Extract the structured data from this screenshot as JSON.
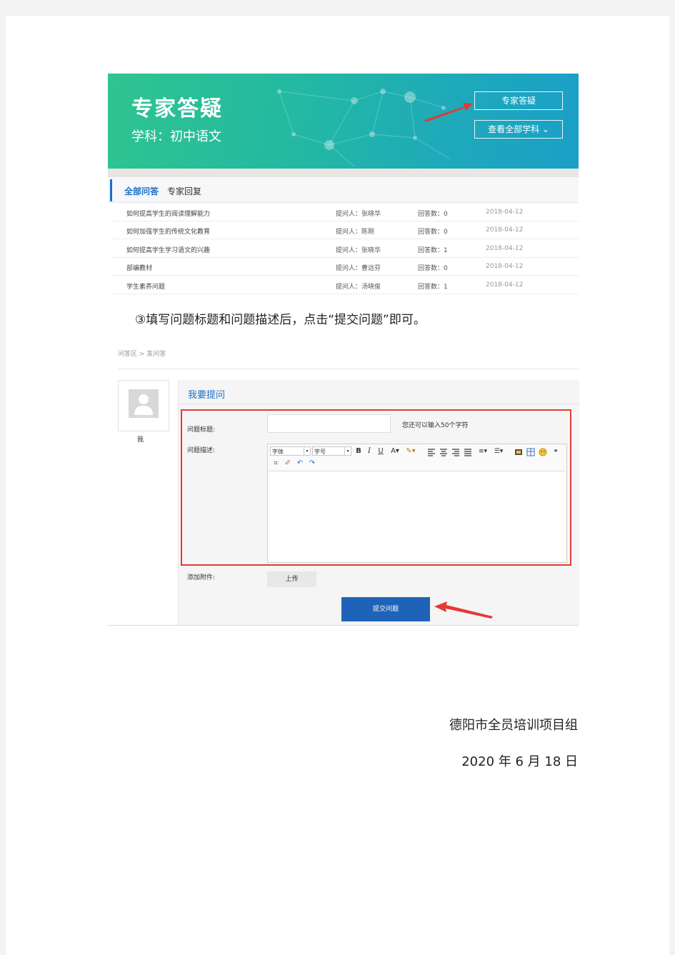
{
  "banner": {
    "title": "专家答疑",
    "subject": "学科：初中语文",
    "btn_expert": "专家答疑",
    "btn_all_subjects": "查看全部学科 ⌄"
  },
  "tabs": [
    "全部问答",
    "专家回复"
  ],
  "questions": [
    {
      "title": "如何提高学生的阅读理解能力",
      "asker": "提问人：张晓华",
      "answers": "回答数：0",
      "date": "2018-04-12"
    },
    {
      "title": "如何加强学生的传统文化教育",
      "asker": "提问人：陈刚",
      "answers": "回答数：0",
      "date": "2018-04-12"
    },
    {
      "title": "如何提高学生学习语文的兴趣",
      "asker": "提问人：张晓华",
      "answers": "回答数：1",
      "date": "2018-04-12"
    },
    {
      "title": "部编教材",
      "asker": "提问人：曹远芬",
      "answers": "回答数：0",
      "date": "2018-04-12"
    },
    {
      "title": "学生素养问题",
      "asker": "提问人：汤晓俊",
      "answers": "回答数：1",
      "date": "2018-04-12"
    }
  ],
  "instruction": "③填写问题标题和问题描述后，点击“提交问题”即可。",
  "form": {
    "breadcrumb": "问答区 > 发问答",
    "user_name": "我",
    "panel_title": "我要提问",
    "title_label": "问题标题:",
    "title_value": "",
    "title_hint": "您还可以输入50个字符",
    "desc_label": "问题描述:",
    "font_select": "字体",
    "size_select": "字号",
    "attach_label": "添加附件:",
    "upload_label": "上传",
    "submit_label": "提交问题"
  },
  "colors": {
    "accent": "#1b6fc6",
    "submit": "#1f63b8",
    "highlight": "#e53935"
  },
  "signature": {
    "org": "德阳市全员培训项目组",
    "date": "2020 年 6 月 18 日"
  }
}
